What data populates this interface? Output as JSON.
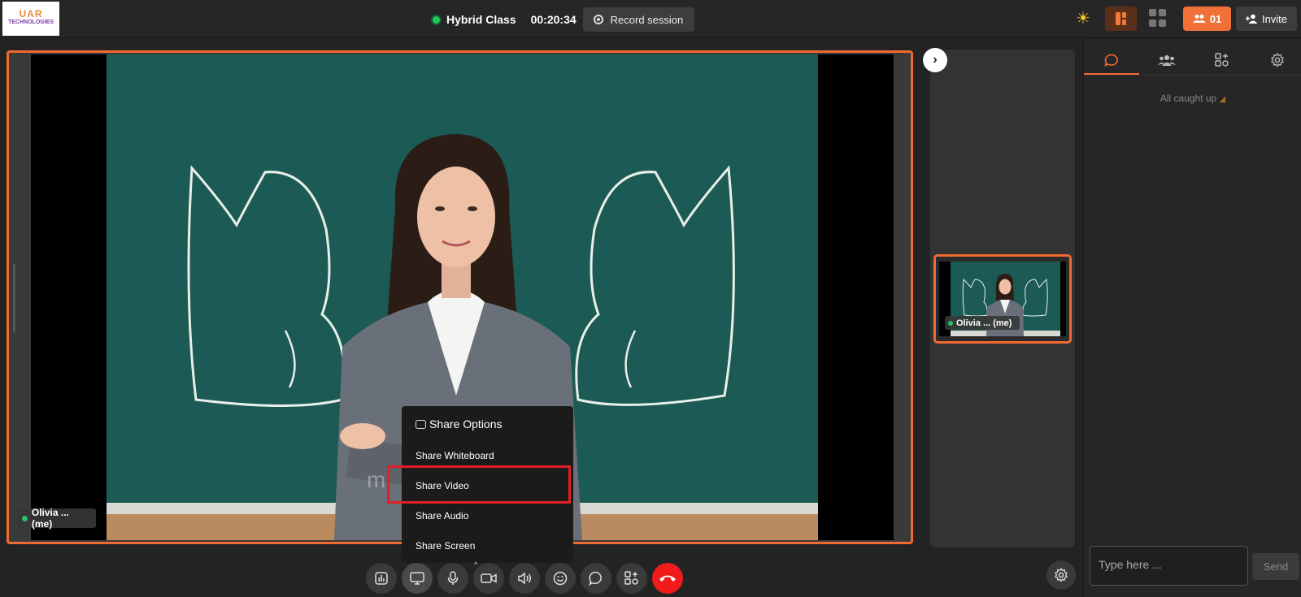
{
  "logo": {
    "line1": "UAR",
    "line2": "TECHNOLOGIES"
  },
  "header": {
    "class_title": "Hybrid Class",
    "timer": "00:20:34",
    "record_label": "Record session",
    "participants_count": "01",
    "invite_label": "Invite"
  },
  "main_video": {
    "participant_label": "Olivia ... (me)",
    "watermark": "mi"
  },
  "thumbnail": {
    "participant_label": "Olivia ... (me)"
  },
  "share_menu": {
    "title": "Share Options",
    "items": [
      "Share Whiteboard",
      "Share Video",
      "Share Audio",
      "Share Screen"
    ],
    "highlighted": "Share Video"
  },
  "right_panel": {
    "tabs": [
      "chat-icon",
      "participants-icon",
      "apps-icon",
      "settings-icon"
    ],
    "active_tab": "chat-icon",
    "status": "All caught up",
    "chat_placeholder": "Type here ...",
    "send_label": "Send"
  },
  "controls": [
    "poll-icon",
    "share-screen-icon",
    "microphone-icon",
    "camera-icon",
    "speaker-icon",
    "emoji-icon",
    "chat-icon",
    "apps-icon",
    "end-call-icon"
  ],
  "colors": {
    "accent": "#f06a30",
    "live": "#22c55e",
    "end_call": "#f01c1c",
    "highlight": "#e21f26"
  }
}
